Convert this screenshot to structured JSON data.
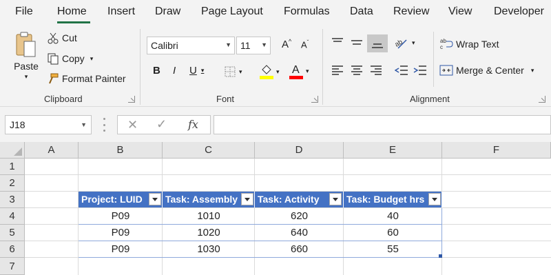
{
  "menu": {
    "tabs": [
      "File",
      "Home",
      "Insert",
      "Draw",
      "Page Layout",
      "Formulas",
      "Data",
      "Review",
      "View",
      "Developer"
    ],
    "active": "Home"
  },
  "ribbon": {
    "clipboard": {
      "paste": "Paste",
      "cut": "Cut",
      "copy": "Copy",
      "format_painter": "Format Painter",
      "label": "Clipboard"
    },
    "font": {
      "font_name": "Calibri",
      "font_size": "11",
      "bold": "B",
      "italic": "I",
      "underline": "U",
      "label": "Font",
      "highlight_color": "#ffff00",
      "font_color": "#ff0000"
    },
    "alignment": {
      "wrap_text": "Wrap Text",
      "merge_center": "Merge & Center",
      "label": "Alignment"
    }
  },
  "formula_bar": {
    "name_box": "J18",
    "fx": "fx",
    "formula": ""
  },
  "grid": {
    "columns": [
      "A",
      "B",
      "C",
      "D",
      "E",
      "F"
    ],
    "rows": [
      "1",
      "2",
      "3",
      "4",
      "5",
      "6",
      "7"
    ],
    "table": {
      "headers": [
        "Project: LUID",
        "Task: Assembly",
        "Task: Activity",
        "Task: Budget hrs"
      ],
      "rows": [
        [
          "P09",
          "1010",
          "620",
          "40"
        ],
        [
          "P09",
          "1020",
          "640",
          "60"
        ],
        [
          "P09",
          "1030",
          "660",
          "55"
        ]
      ],
      "header_color": "#4472c4"
    }
  },
  "colors": {
    "accent": "#217346"
  }
}
